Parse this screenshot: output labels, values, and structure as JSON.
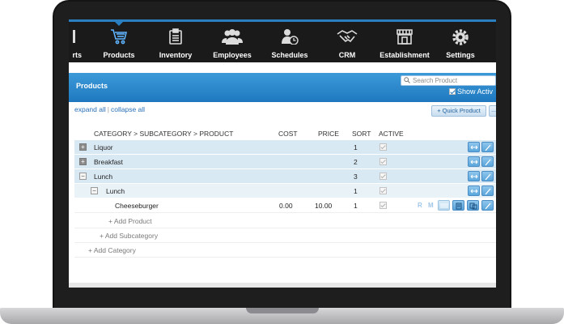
{
  "nav": {
    "items": [
      {
        "label": "rts",
        "icon": "reports-icon"
      },
      {
        "label": "Products",
        "icon": "cart-icon",
        "active": true
      },
      {
        "label": "Inventory",
        "icon": "clipboard-icon"
      },
      {
        "label": "Employees",
        "icon": "users-icon"
      },
      {
        "label": "Schedules",
        "icon": "user-clock-icon"
      },
      {
        "label": "CRM",
        "icon": "handshake-icon"
      },
      {
        "label": "Establishment",
        "icon": "storefront-icon"
      },
      {
        "label": "Settings",
        "icon": "gear-icon"
      }
    ]
  },
  "header": {
    "title": "Products",
    "search_placeholder": "Search Product",
    "show_active_label": "Show Activ",
    "show_active_checked": true
  },
  "toolbar": {
    "expand_all": "expand all",
    "separator": "|",
    "collapse_all": "collapse all",
    "quick_product": "+ Quick Product",
    "extra_button": "..."
  },
  "table": {
    "columns": {
      "name": "CATEGORY > SUBCATEGORY > PRODUCT",
      "cost": "COST",
      "price": "PRICE",
      "sort": "SORT",
      "active": "ACTIVE"
    },
    "rows": [
      {
        "kind": "category",
        "toggle": "+",
        "name": "Liquor",
        "sort": "1"
      },
      {
        "kind": "category",
        "toggle": "+",
        "name": "Breakfast",
        "sort": "2"
      },
      {
        "kind": "category",
        "toggle": "−",
        "name": "Lunch",
        "sort": "3"
      },
      {
        "kind": "subcategory",
        "toggle": "−",
        "name": "Lunch",
        "sort": "1"
      },
      {
        "kind": "product",
        "name": "Cheeseburger",
        "cost": "0.00",
        "price": "10.00",
        "sort": "1",
        "r": "R",
        "m": "M"
      }
    ],
    "add_product": "+ Add  Product",
    "add_subcategory": "+ Add  Subcategory",
    "add_category": "+ Add  Category"
  },
  "colors": {
    "accent": "#2a7fc1",
    "header_blue": "#2d89cd",
    "category_row": "#d9e9f3",
    "nav_bg": "#1a1a1a"
  }
}
